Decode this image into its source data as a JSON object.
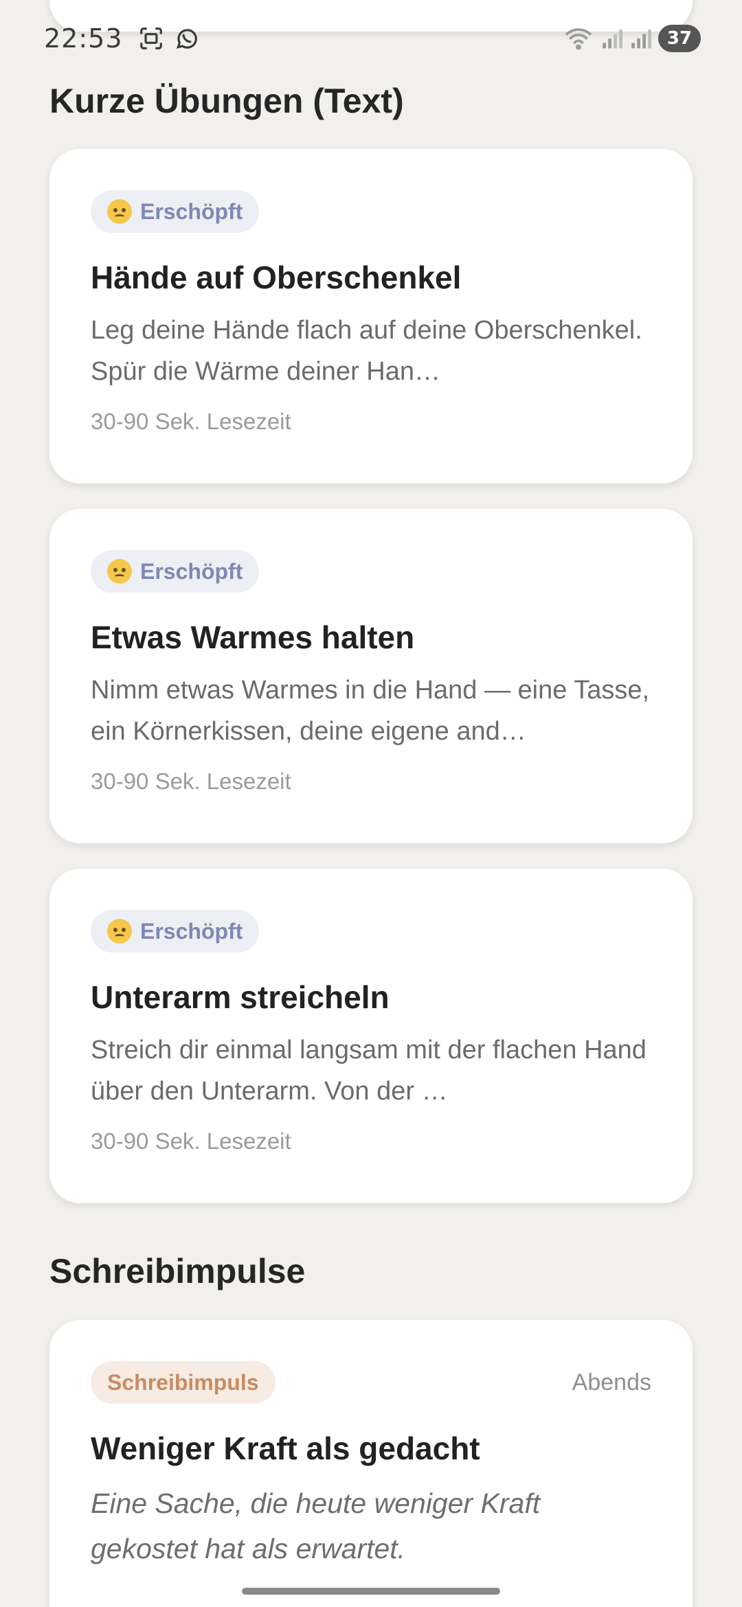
{
  "status_bar": {
    "time": "22:53",
    "battery": "37",
    "left_icons": [
      "screenshot-icon",
      "whatsapp-icon"
    ],
    "right_icons": [
      "wifi-icon",
      "signal-icon",
      "signal-icon"
    ]
  },
  "sections": {
    "short_exercises_title": "Kurze Übungen (Text)",
    "writing_prompts_title": "Schreibimpulse"
  },
  "exercises": [
    {
      "tag": "Erschöpft",
      "title": "Hände auf Oberschenkel",
      "description": "Leg deine Hände flach auf deine Oberschenkel. Spür die Wärme deiner Han…",
      "meta": "30-90 Sek. Lesezeit"
    },
    {
      "tag": "Erschöpft",
      "title": "Etwas Warmes halten",
      "description": "Nimm etwas Warmes in die Hand — eine Tasse, ein Körnerkissen, deine eigene and…",
      "meta": "30-90 Sek. Lesezeit"
    },
    {
      "tag": "Erschöpft",
      "title": "Unterarm streicheln",
      "description": "Streich dir einmal langsam mit der flachen Hand über den Unterarm. Von der …",
      "meta": "30-90 Sek. Lesezeit"
    }
  ],
  "writing_prompt": {
    "tag": "Schreibimpuls",
    "time_of_day": "Abends",
    "title": "Weniger Kraft als gedacht",
    "text": "Eine Sache, die heute weniger Kraft gekostet hat als erwartet."
  },
  "colors": {
    "background": "#f2f0ec",
    "mood_chip_bg": "#eeeff4",
    "mood_chip_text": "#7d89b4",
    "impulse_chip_bg": "#f7ece3",
    "impulse_chip_text": "#c88b62"
  }
}
